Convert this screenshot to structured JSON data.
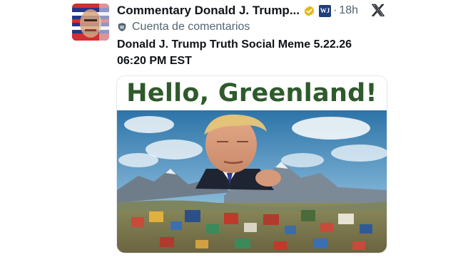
{
  "post": {
    "author_name": "Commentary Donald J. Trump...",
    "org_badge_text": "WJ",
    "separator": "·",
    "time": "18h",
    "account_label": "Cuenta de comentarios",
    "text_line1": "Donald J. Trump Truth Social Meme 5.22.26",
    "text_line2": "06:20 PM EST"
  },
  "media": {
    "meme_title": "Hello, Greenland!"
  },
  "icons": {
    "verified": "verified-badge-icon",
    "org": "org-affiliation-icon",
    "platform": "x-logo-icon",
    "label": "government-label-icon"
  },
  "colors": {
    "text_primary": "#0f1419",
    "text_secondary": "#536471",
    "verified_gold": "#e2b719",
    "meme_title": "#2f5a2c",
    "org_badge": "#1d3f7a"
  }
}
